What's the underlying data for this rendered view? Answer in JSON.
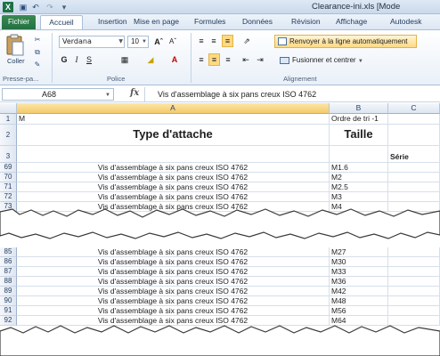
{
  "window": {
    "title": "Clearance-ini.xls  [Mode"
  },
  "tabs": {
    "file": "Fichier",
    "items": [
      "Accueil",
      "Insertion",
      "Mise en page",
      "Formules",
      "Données",
      "Révision",
      "Affichage",
      "Autodesk"
    ]
  },
  "ribbon": {
    "paste_label": "Coller",
    "font_name": "Verdana",
    "font_size": "10",
    "bold": "G",
    "italic": "I",
    "underline": "S",
    "wrap_text": "Renvoyer à la ligne automatiquement",
    "merge_center": "Fusionner et centrer",
    "groups": {
      "clipboard": "Presse-pa...",
      "font": "Police",
      "alignment": "Alignement"
    }
  },
  "formula_bar": {
    "name_box": "A68",
    "fx": "fx",
    "content": "Vis d'assemblage à six pans creux ISO 4762"
  },
  "columns": [
    "A",
    "B",
    "C"
  ],
  "header_rows": [
    {
      "row": "1",
      "a": "M",
      "b": "Ordre de tri -1",
      "c": ""
    },
    {
      "row": "2",
      "a": "Type d'attache",
      "b": "Taille",
      "c": ""
    },
    {
      "row": "3",
      "a": "",
      "b": "",
      "c": "Série"
    }
  ],
  "rows_top": [
    {
      "row": "69",
      "a": "Vis d'assemblage à six pans creux ISO 4762",
      "b": "M1.6"
    },
    {
      "row": "70",
      "a": "Vis d'assemblage à six pans creux ISO 4762",
      "b": "M2"
    },
    {
      "row": "71",
      "a": "Vis d'assemblage à six pans creux ISO 4762",
      "b": "M2.5"
    },
    {
      "row": "72",
      "a": "Vis d'assemblage à six pans creux ISO 4762",
      "b": "M3"
    },
    {
      "row": "73",
      "a": "Vis d'assemblage à six pans creux ISO 4762",
      "b": "M4"
    }
  ],
  "rows_bottom": [
    {
      "row": "85",
      "a": "Vis d'assemblage à six pans creux ISO 4762",
      "b": "M27"
    },
    {
      "row": "86",
      "a": "Vis d'assemblage à six pans creux ISO 4762",
      "b": "M30"
    },
    {
      "row": "87",
      "a": "Vis d'assemblage à six pans creux ISO 4762",
      "b": "M33"
    },
    {
      "row": "88",
      "a": "Vis d'assemblage à six pans creux ISO 4762",
      "b": "M36"
    },
    {
      "row": "89",
      "a": "Vis d'assemblage à six pans creux ISO 4762",
      "b": "M42"
    },
    {
      "row": "90",
      "a": "Vis d'assemblage à six pans creux ISO 4762",
      "b": "M48"
    },
    {
      "row": "91",
      "a": "Vis d'assemblage à six pans creux ISO 4762",
      "b": "M56"
    },
    {
      "row": "92",
      "a": "Vis d'assemblage à six pans creux ISO 4762",
      "b": "M64"
    }
  ],
  "colors": {
    "file_tab": "#227044",
    "selected_column": "#f5c96a",
    "wrap_highlight": "#ffd982"
  }
}
